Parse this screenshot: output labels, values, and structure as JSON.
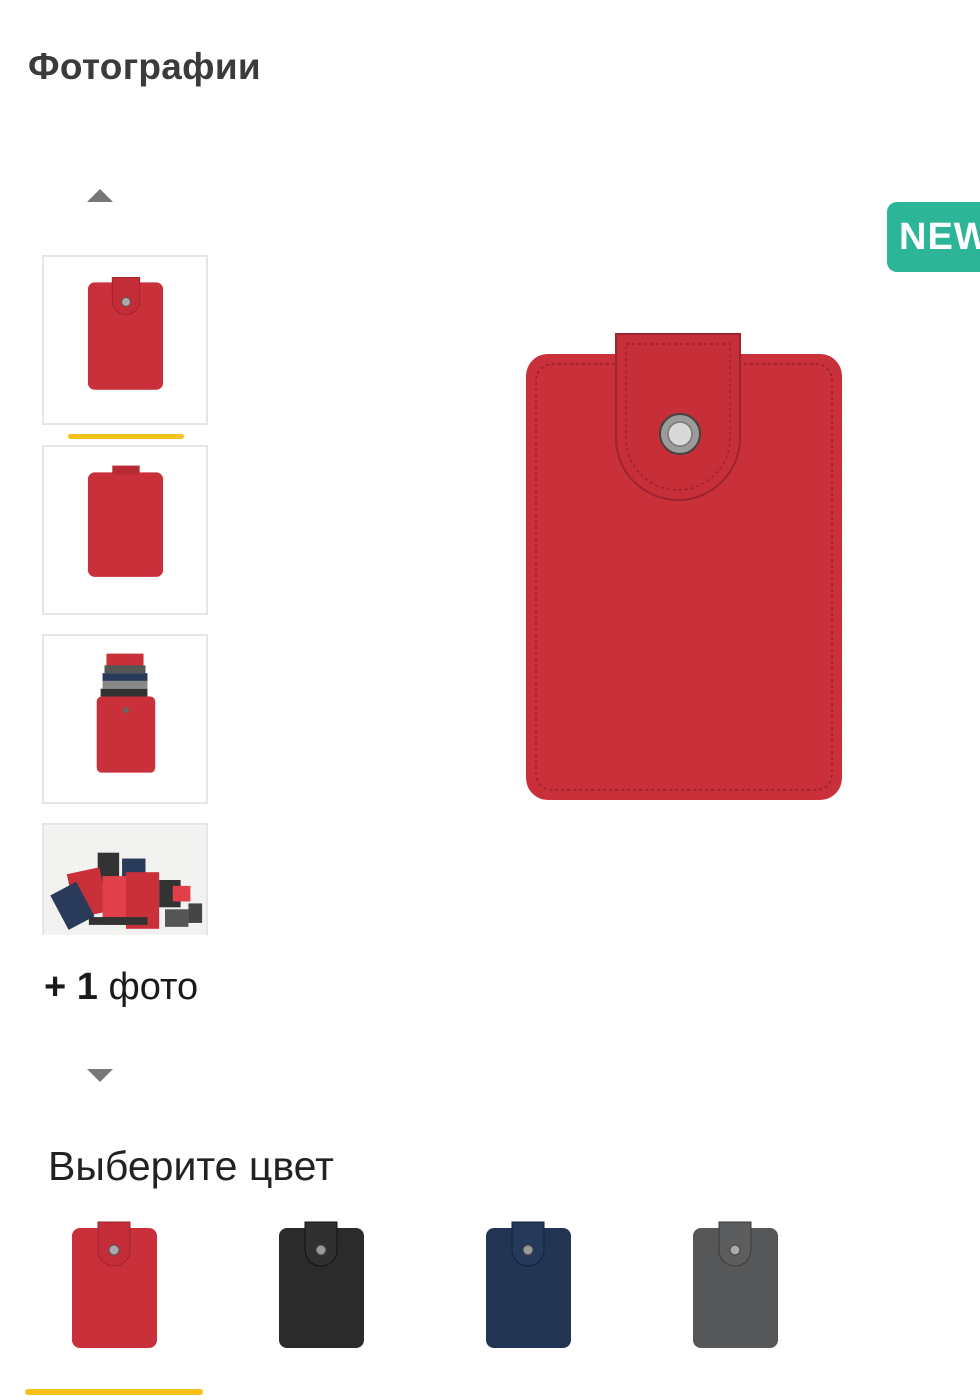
{
  "gallery": {
    "title": "Фотографии",
    "more_photos": {
      "count": "+ 1",
      "label": " фото"
    },
    "badge": "NEW",
    "product_color": "#c9303a"
  },
  "color_picker": {
    "title": "Выберите цвет",
    "options": [
      {
        "color": "#c9303a",
        "selected": true
      },
      {
        "color": "#2b2b2b",
        "selected": false
      },
      {
        "color": "#223552",
        "selected": false
      },
      {
        "color": "#555758",
        "selected": false
      }
    ]
  },
  "colors": {
    "accent": "#f5c21b",
    "badge": "#2cb596"
  }
}
